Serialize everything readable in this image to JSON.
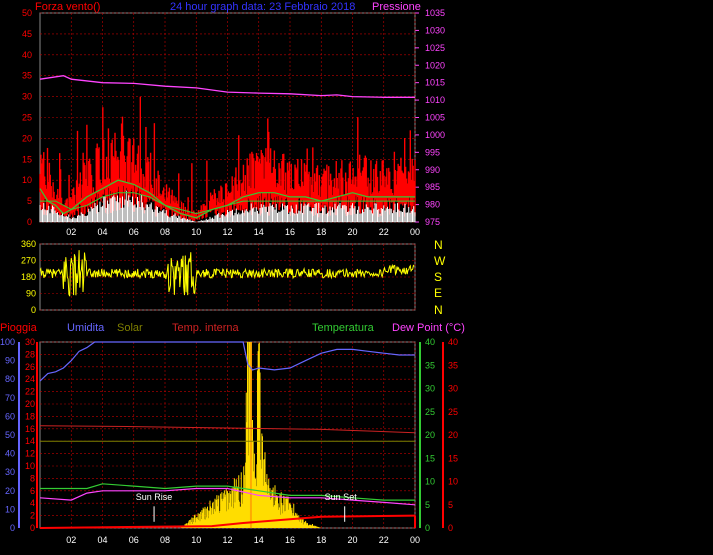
{
  "header": {
    "left": "Forza vento()",
    "center": "24 hour graph data: 23 Febbraio 2018",
    "right": "Pressione"
  },
  "dir_labels": [
    "N",
    "W",
    "S",
    "E",
    "N"
  ],
  "bottom_headers": {
    "rain": "Pioggia",
    "humidity": "Umidita",
    "solar": "Solar",
    "temp_in": "Temp. interna",
    "temp": "Temperatura",
    "dew": "Dew Point (°C)"
  },
  "colors": {
    "grid": "#c00000",
    "wind": "#ff0000",
    "gust": "#33cc33",
    "avg": "#ffffff",
    "pressure": "#ff44ff",
    "winddir": "#ffff00",
    "humidity": "#6666ff",
    "solar": "#ffaa00",
    "temp_in": "#cc2222",
    "temp": "#33cc33",
    "dew": "#ff44ff",
    "rain": "#ff0000"
  },
  "chart_data": [
    {
      "type": "line",
      "name": "wind",
      "x_ticks": [
        "02",
        "04",
        "06",
        "08",
        "10",
        "12",
        "14",
        "16",
        "18",
        "20",
        "22",
        "00"
      ],
      "y_left_ticks": [
        "0",
        "5",
        "10",
        "15",
        "20",
        "25",
        "30",
        "35",
        "40",
        "45",
        "50"
      ],
      "y_right_ticks": [
        "975",
        "980",
        "985",
        "990",
        "995",
        "1000",
        "1005",
        "1010",
        "1015",
        "1020",
        "1025",
        "1030",
        "1035"
      ],
      "ylim_left": [
        0,
        50
      ],
      "ylim_right": [
        975,
        1035
      ],
      "pressure": [
        [
          0,
          1016
        ],
        [
          1.5,
          1017
        ],
        [
          2,
          1016
        ],
        [
          4,
          1015
        ],
        [
          6,
          1014.8
        ],
        [
          8,
          1014
        ],
        [
          10,
          1013.5
        ],
        [
          12,
          1012.3
        ],
        [
          14,
          1012
        ],
        [
          16,
          1011.8
        ],
        [
          18,
          1011.3
        ],
        [
          19,
          1011.5
        ],
        [
          20,
          1011
        ],
        [
          22,
          1010.8
        ],
        [
          24,
          1010.8
        ]
      ],
      "gust": [
        [
          0,
          8
        ],
        [
          0.5,
          5
        ],
        [
          1,
          4
        ],
        [
          1.5,
          2
        ],
        [
          2,
          3
        ],
        [
          3,
          6
        ],
        [
          4,
          8
        ],
        [
          5,
          10
        ],
        [
          6,
          9
        ],
        [
          7,
          7
        ],
        [
          8,
          4
        ],
        [
          9,
          2
        ],
        [
          10,
          1
        ],
        [
          11,
          3
        ],
        [
          12,
          4
        ],
        [
          13,
          6
        ],
        [
          14,
          7
        ],
        [
          15,
          7
        ],
        [
          16,
          6
        ],
        [
          17,
          6
        ],
        [
          18,
          5
        ],
        [
          19,
          6
        ],
        [
          20,
          7
        ],
        [
          21,
          6
        ],
        [
          22,
          6
        ],
        [
          23,
          6
        ],
        [
          24,
          6
        ]
      ],
      "avg": [
        [
          0,
          3
        ],
        [
          1,
          3
        ],
        [
          2,
          1
        ],
        [
          3,
          2
        ],
        [
          4,
          4
        ],
        [
          5,
          5
        ],
        [
          6,
          5
        ],
        [
          7,
          4
        ],
        [
          8,
          2
        ],
        [
          9,
          1
        ],
        [
          10,
          0
        ],
        [
          11,
          1
        ],
        [
          12,
          2
        ],
        [
          13,
          3
        ],
        [
          14,
          3
        ],
        [
          15,
          3
        ],
        [
          16,
          3
        ],
        [
          17,
          3
        ],
        [
          18,
          3
        ],
        [
          19,
          3
        ],
        [
          20,
          3
        ],
        [
          21,
          3
        ],
        [
          22,
          3
        ],
        [
          23,
          3
        ],
        [
          24,
          3
        ]
      ]
    },
    {
      "type": "line",
      "name": "wind_direction",
      "y_ticks": [
        "360",
        "270",
        "180",
        "90",
        "0"
      ],
      "ylim": [
        0,
        360
      ],
      "x_ticks": [
        "02",
        "04",
        "06",
        "08",
        "10",
        "12",
        "14",
        "16",
        "18",
        "20",
        "22",
        "00"
      ]
    },
    {
      "type": "line",
      "name": "environment",
      "x_ticks": [
        "02",
        "04",
        "06",
        "08",
        "10",
        "12",
        "14",
        "16",
        "18",
        "20",
        "22",
        "00"
      ],
      "y_hum_ticks": [
        "0",
        "10",
        "20",
        "30",
        "40",
        "50",
        "60",
        "70",
        "80",
        "90",
        "100"
      ],
      "y_rain_ticks": [
        "0",
        "2",
        "4",
        "6",
        "8",
        "10",
        "12",
        "14",
        "16",
        "18",
        "20",
        "22",
        "24",
        "26",
        "28",
        "30"
      ],
      "y_temp_ticks": [
        "0",
        "5",
        "10",
        "15",
        "20",
        "25",
        "30",
        "35",
        "40"
      ],
      "y_dew_ticks": [
        "0",
        "5",
        "10",
        "15",
        "20",
        "25",
        "30",
        "35",
        "40"
      ],
      "annotations": [
        "Sun Rise",
        "Sun Set"
      ],
      "humidity": [
        [
          0,
          79
        ],
        [
          0.5,
          83
        ],
        [
          1,
          84
        ],
        [
          1.5,
          86
        ],
        [
          2,
          90
        ],
        [
          2.5,
          95
        ],
        [
          3,
          97
        ],
        [
          3.5,
          100
        ],
        [
          4,
          100
        ],
        [
          6,
          100
        ],
        [
          8,
          100
        ],
        [
          10,
          100
        ],
        [
          12,
          100
        ],
        [
          13,
          100
        ],
        [
          13.3,
          88
        ],
        [
          13.6,
          85
        ],
        [
          14,
          86
        ],
        [
          15,
          85
        ],
        [
          16,
          86
        ],
        [
          17,
          90
        ],
        [
          18,
          94
        ],
        [
          19,
          96
        ],
        [
          20,
          96
        ],
        [
          21,
          95
        ],
        [
          22,
          94
        ],
        [
          23,
          93
        ],
        [
          24,
          93
        ]
      ],
      "solar_in": [
        [
          0,
          14
        ],
        [
          12,
          14
        ],
        [
          18,
          14
        ],
        [
          24,
          14
        ]
      ],
      "temp_in_line": [
        [
          0,
          22
        ],
        [
          6,
          21.8
        ],
        [
          12,
          21.5
        ],
        [
          18,
          21.2
        ],
        [
          24,
          20.5
        ]
      ],
      "temperature": [
        [
          0,
          8.5
        ],
        [
          3,
          8.5
        ],
        [
          4,
          9.5
        ],
        [
          6,
          9
        ],
        [
          8,
          8.5
        ],
        [
          10,
          9
        ],
        [
          12,
          9
        ],
        [
          14,
          8
        ],
        [
          16,
          7
        ],
        [
          18,
          7
        ],
        [
          20,
          6.5
        ],
        [
          22,
          6
        ],
        [
          24,
          6
        ]
      ],
      "dew_point": [
        [
          0,
          6.5
        ],
        [
          2,
          6
        ],
        [
          3,
          7.5
        ],
        [
          4,
          8
        ],
        [
          6,
          8
        ],
        [
          8,
          8
        ],
        [
          10,
          8.5
        ],
        [
          12,
          8.5
        ],
        [
          14,
          7
        ],
        [
          16,
          6.5
        ],
        [
          18,
          6.5
        ],
        [
          20,
          6
        ],
        [
          22,
          5.5
        ],
        [
          24,
          5
        ]
      ],
      "solar_curve": [
        [
          0,
          0
        ],
        [
          9,
          0
        ],
        [
          10,
          2
        ],
        [
          11,
          4
        ],
        [
          12,
          6
        ],
        [
          13,
          8
        ],
        [
          13.4,
          30
        ],
        [
          13.8,
          10
        ],
        [
          14,
          25
        ],
        [
          14.5,
          8
        ],
        [
          15,
          6
        ],
        [
          16,
          4
        ],
        [
          17,
          1
        ],
        [
          18,
          0
        ],
        [
          24,
          0
        ]
      ],
      "rain_line": [
        [
          0,
          0
        ],
        [
          11,
          0.3
        ],
        [
          13,
          0.8
        ],
        [
          16,
          1.4
        ],
        [
          18,
          1.8
        ],
        [
          24,
          2
        ]
      ]
    }
  ]
}
